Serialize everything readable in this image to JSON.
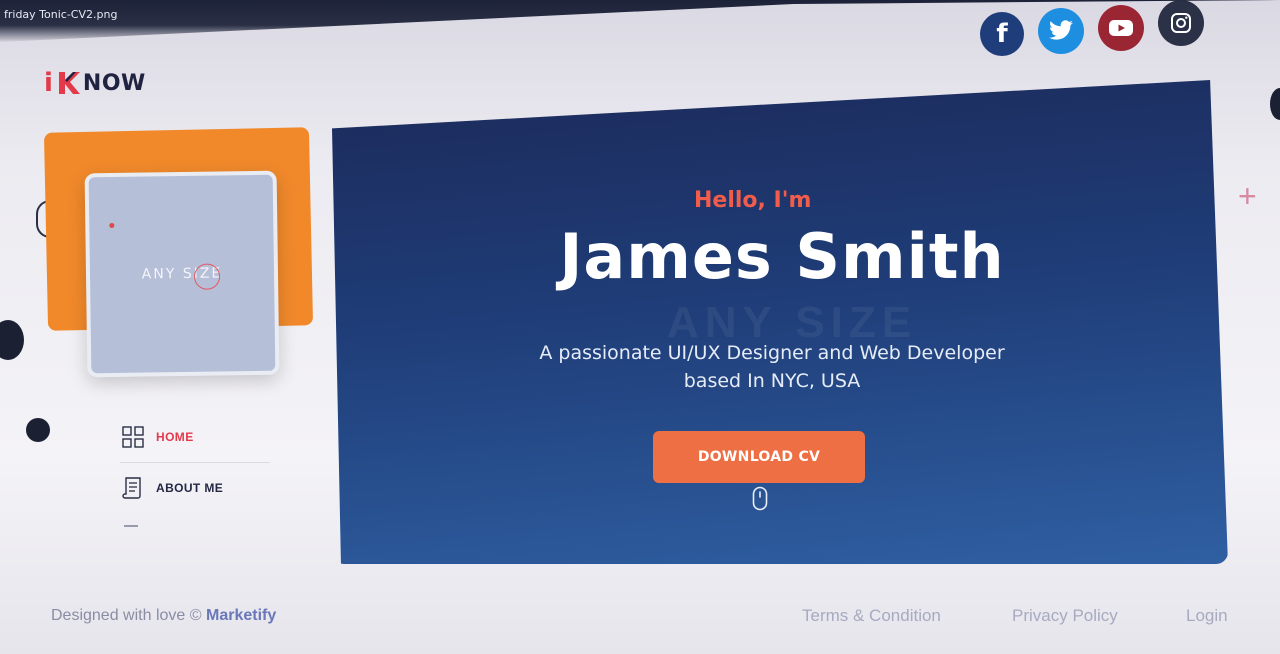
{
  "window": {
    "title": "friday Tonic-CV2.png"
  },
  "social": [
    {
      "name": "facebook",
      "label": "f",
      "color": "#1f3d7a"
    },
    {
      "name": "twitter",
      "color": "#1e8fe0"
    },
    {
      "name": "youtube",
      "color": "#9a2634"
    },
    {
      "name": "instagram",
      "color": "#2b3146"
    }
  ],
  "logo": {
    "i": "i",
    "now": "NOW",
    "accent": "#e23a4a"
  },
  "photo": {
    "placeholder": "ANY SIZE"
  },
  "nav": {
    "items": [
      {
        "label": "HOME",
        "icon": "grid-icon",
        "active": true
      },
      {
        "label": "ABOUT ME",
        "icon": "document-icon",
        "active": false
      }
    ]
  },
  "hero": {
    "greeting": "Hello, I'm",
    "name": "James Smith",
    "watermark": "ANY SIZE",
    "subtitle_line1": "A passionate UI/UX Designer and Web Developer",
    "subtitle_line2": "based In NYC, USA",
    "cta_label": "DOWNLOAD CV",
    "accent": "#ee6f43"
  },
  "footer": {
    "credit_prefix": "Designed with love © ",
    "credit_brand": "Marketify",
    "links": [
      "Terms & Condition",
      "Privacy Policy",
      "Login"
    ]
  }
}
